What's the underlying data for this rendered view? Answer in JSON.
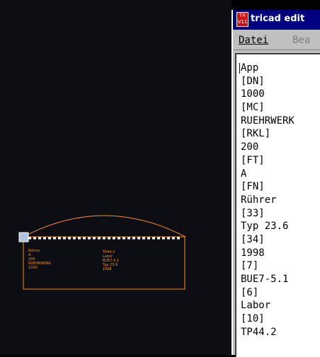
{
  "cad": {
    "colors": {
      "background": "#0d0d14",
      "outline": "#ff8c1a",
      "dash_line": "#ffffff",
      "marker": "#b0c4de"
    },
    "labels_left": [
      "Rührer",
      "A",
      "200",
      "RUEHRWERK",
      "1000"
    ],
    "labels_right": [
      "TP44.2",
      "Labor",
      "BUE7-5.1",
      "Typ 23.6",
      "1998"
    ]
  },
  "editor": {
    "title": "tricad edit",
    "icon_text": [
      "TR",
      "V11"
    ],
    "menu": {
      "file": "Datei",
      "edit": "Bea"
    },
    "lines": [
      "App",
      "[DN]",
      "1000",
      "[MC]",
      "RUEHRWERK",
      "[RKL]",
      "200",
      "[FT]",
      "A",
      "[FN]",
      "Rührer",
      "[33]",
      "Typ 23.6",
      "[34]",
      "1998",
      "[7]",
      "BUE7-5.1",
      "[6]",
      "Labor",
      "[10]",
      "TP44.2"
    ]
  }
}
